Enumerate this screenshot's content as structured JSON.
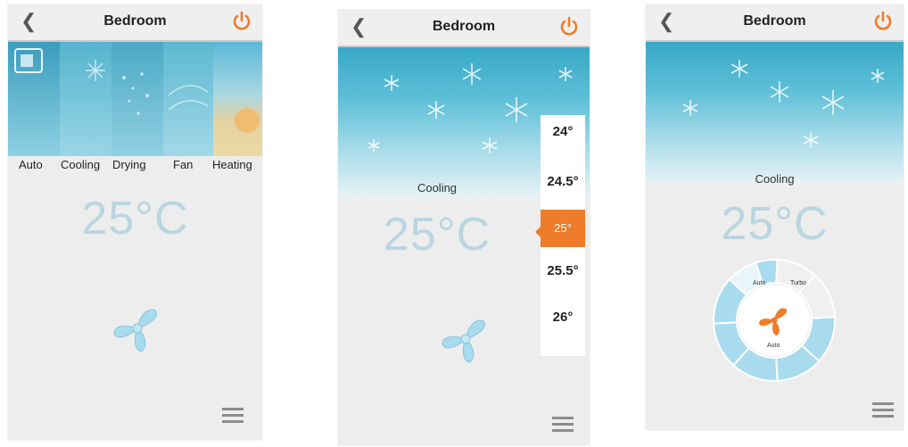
{
  "screens": [
    {
      "title": "Bedroom",
      "back_icon": "chevron-left-icon",
      "power_icon": "power-icon",
      "modes": [
        "Auto",
        "Cooling",
        "Drying",
        "Fan",
        "Heating"
      ],
      "temperature": "25°C",
      "menu_icon": "hamburger-menu-icon"
    },
    {
      "title": "Bedroom",
      "mode": "Cooling",
      "temperature": "25°C",
      "picker_values": [
        "24°",
        "24.5°",
        "25°",
        "25.5°",
        "26°"
      ],
      "picker_selected": "25°"
    },
    {
      "title": "Bedroom",
      "mode": "Cooling",
      "temperature": "25°C",
      "fan_dial": {
        "options": [
          "Auto",
          "Turbo"
        ],
        "center_label": "Auto"
      }
    }
  ],
  "colors": {
    "accent": "#ee7c2a",
    "sky": "#4fb3cf",
    "temp_text": "#b9d6e0",
    "fan_blue": "#a9dbee"
  }
}
